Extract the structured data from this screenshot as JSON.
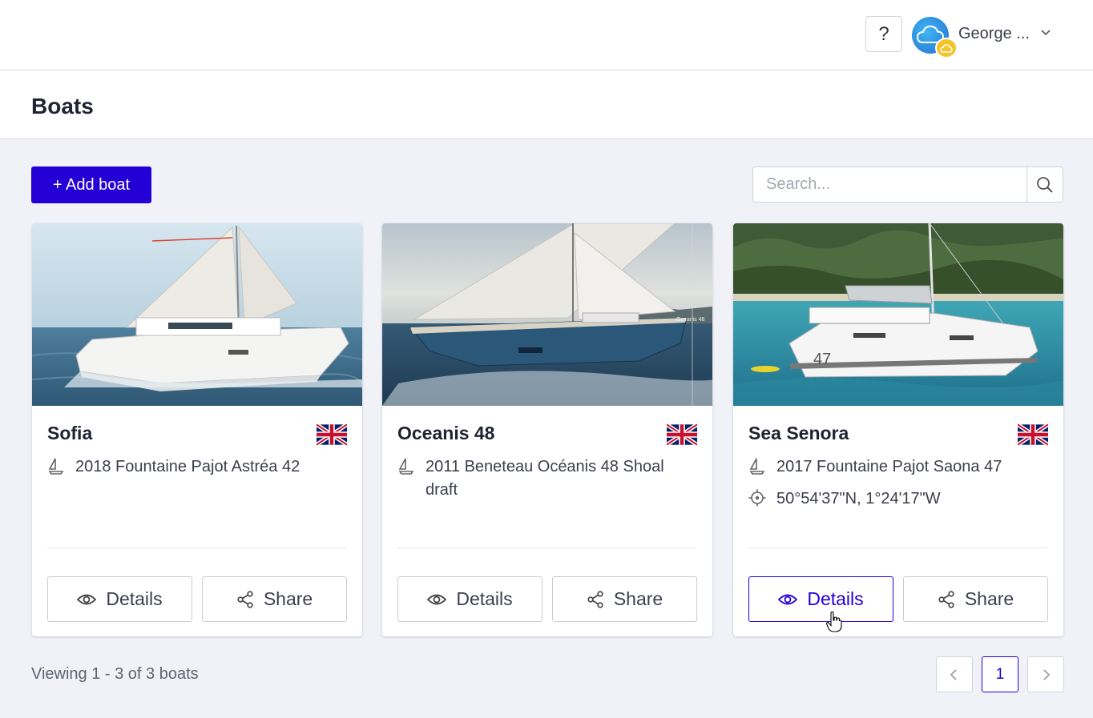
{
  "topbar": {
    "help_label": "?",
    "user_name": "George ..."
  },
  "page": {
    "title": "Boats"
  },
  "toolbar": {
    "add_label": "+ Add boat",
    "search_placeholder": "Search..."
  },
  "boats": [
    {
      "name": "Sofia",
      "flag": "uk-flag",
      "model": "2018 Fountaine Pajot Astréa 42",
      "details_label": "Details",
      "share_label": "Share"
    },
    {
      "name": "Oceanis 48",
      "flag": "uk-flag",
      "model": "2011 Beneteau Océanis 48 Shoal draft",
      "image_caption": "Oceanis 48",
      "details_label": "Details",
      "share_label": "Share"
    },
    {
      "name": "Sea Senora",
      "flag": "uk-flag",
      "model": "2017 Fountaine Pajot Saona 47",
      "location": "50°54'37\"N, 1°24'17\"W",
      "hull_number": "47",
      "details_label": "Details",
      "share_label": "Share"
    }
  ],
  "footer": {
    "viewing_text": "Viewing 1 - 3 of 3 boats",
    "prev_icon": "chevron-left-icon",
    "current_page": "1",
    "next_icon": "chevron-right-icon"
  },
  "colors": {
    "accent": "#2400d6",
    "background": "#f0f2f7"
  }
}
